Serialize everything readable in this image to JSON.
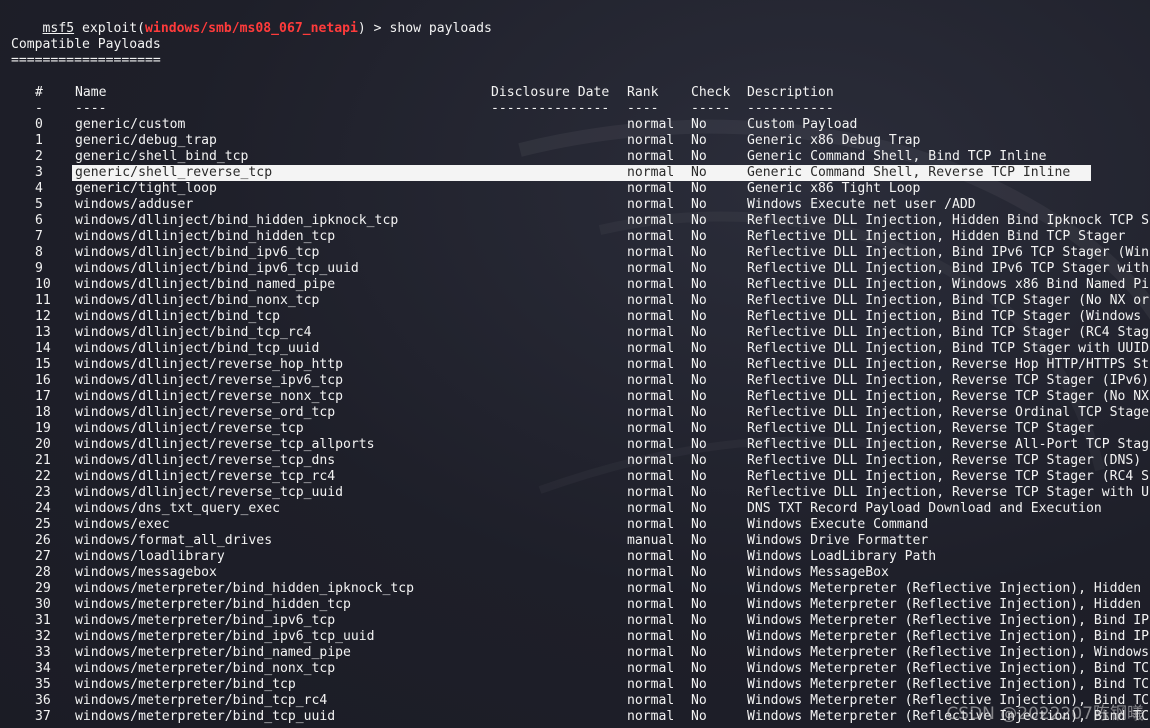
{
  "prompt": {
    "msf": "msf5",
    "exploit_prefix": " exploit(",
    "module": "windows/smb/ms08_067_netapi",
    "exploit_suffix": ") > ",
    "command": "show payloads"
  },
  "section_title": "Compatible Payloads",
  "section_underline": "===================",
  "headers": {
    "num": "#",
    "name": "Name",
    "disclosure": "Disclosure Date",
    "rank": "Rank",
    "check": "Check",
    "description": "Description"
  },
  "dividers": {
    "num": "-",
    "name": "----",
    "disclosure": "---------------",
    "rank": "----",
    "check": "-----",
    "description": "-----------"
  },
  "highlight_row": 3,
  "rows": [
    {
      "num": "0",
      "name": "generic/custom",
      "rank": "normal",
      "check": "No",
      "desc": "Custom Payload"
    },
    {
      "num": "1",
      "name": "generic/debug_trap",
      "rank": "normal",
      "check": "No",
      "desc": "Generic x86 Debug Trap"
    },
    {
      "num": "2",
      "name": "generic/shell_bind_tcp",
      "rank": "normal",
      "check": "No",
      "desc": "Generic Command Shell, Bind TCP Inline"
    },
    {
      "num": "3",
      "name": "generic/shell_reverse_tcp",
      "rank": "normal",
      "check": "No",
      "desc": "Generic Command Shell, Reverse TCP Inline"
    },
    {
      "num": "4",
      "name": "generic/tight_loop",
      "rank": "normal",
      "check": "No",
      "desc": "Generic x86 Tight Loop"
    },
    {
      "num": "5",
      "name": "windows/adduser",
      "rank": "normal",
      "check": "No",
      "desc": "Windows Execute net user /ADD"
    },
    {
      "num": "6",
      "name": "windows/dllinject/bind_hidden_ipknock_tcp",
      "rank": "normal",
      "check": "No",
      "desc": "Reflective DLL Injection, Hidden Bind Ipknock TCP S"
    },
    {
      "num": "7",
      "name": "windows/dllinject/bind_hidden_tcp",
      "rank": "normal",
      "check": "No",
      "desc": "Reflective DLL Injection, Hidden Bind TCP Stager"
    },
    {
      "num": "8",
      "name": "windows/dllinject/bind_ipv6_tcp",
      "rank": "normal",
      "check": "No",
      "desc": "Reflective DLL Injection, Bind IPv6 TCP Stager (Win"
    },
    {
      "num": "9",
      "name": "windows/dllinject/bind_ipv6_tcp_uuid",
      "rank": "normal",
      "check": "No",
      "desc": "Reflective DLL Injection, Bind IPv6 TCP Stager with"
    },
    {
      "num": "10",
      "name": "windows/dllinject/bind_named_pipe",
      "rank": "normal",
      "check": "No",
      "desc": "Reflective DLL Injection, Windows x86 Bind Named Pi"
    },
    {
      "num": "11",
      "name": "windows/dllinject/bind_nonx_tcp",
      "rank": "normal",
      "check": "No",
      "desc": "Reflective DLL Injection, Bind TCP Stager (No NX or"
    },
    {
      "num": "12",
      "name": "windows/dllinject/bind_tcp",
      "rank": "normal",
      "check": "No",
      "desc": "Reflective DLL Injection, Bind TCP Stager (Windows"
    },
    {
      "num": "13",
      "name": "windows/dllinject/bind_tcp_rc4",
      "rank": "normal",
      "check": "No",
      "desc": "Reflective DLL Injection, Bind TCP Stager (RC4 Stag"
    },
    {
      "num": "14",
      "name": "windows/dllinject/bind_tcp_uuid",
      "rank": "normal",
      "check": "No",
      "desc": "Reflective DLL Injection, Bind TCP Stager with UUID"
    },
    {
      "num": "15",
      "name": "windows/dllinject/reverse_hop_http",
      "rank": "normal",
      "check": "No",
      "desc": "Reflective DLL Injection, Reverse Hop HTTP/HTTPS St"
    },
    {
      "num": "16",
      "name": "windows/dllinject/reverse_ipv6_tcp",
      "rank": "normal",
      "check": "No",
      "desc": "Reflective DLL Injection, Reverse TCP Stager (IPv6)"
    },
    {
      "num": "17",
      "name": "windows/dllinject/reverse_nonx_tcp",
      "rank": "normal",
      "check": "No",
      "desc": "Reflective DLL Injection, Reverse TCP Stager (No NX"
    },
    {
      "num": "18",
      "name": "windows/dllinject/reverse_ord_tcp",
      "rank": "normal",
      "check": "No",
      "desc": "Reflective DLL Injection, Reverse Ordinal TCP Stage"
    },
    {
      "num": "19",
      "name": "windows/dllinject/reverse_tcp",
      "rank": "normal",
      "check": "No",
      "desc": "Reflective DLL Injection, Reverse TCP Stager"
    },
    {
      "num": "20",
      "name": "windows/dllinject/reverse_tcp_allports",
      "rank": "normal",
      "check": "No",
      "desc": "Reflective DLL Injection, Reverse All-Port TCP Stag"
    },
    {
      "num": "21",
      "name": "windows/dllinject/reverse_tcp_dns",
      "rank": "normal",
      "check": "No",
      "desc": "Reflective DLL Injection, Reverse TCP Stager (DNS)"
    },
    {
      "num": "22",
      "name": "windows/dllinject/reverse_tcp_rc4",
      "rank": "normal",
      "check": "No",
      "desc": "Reflective DLL Injection, Reverse TCP Stager (RC4 S"
    },
    {
      "num": "23",
      "name": "windows/dllinject/reverse_tcp_uuid",
      "rank": "normal",
      "check": "No",
      "desc": "Reflective DLL Injection, Reverse TCP Stager with U"
    },
    {
      "num": "24",
      "name": "windows/dns_txt_query_exec",
      "rank": "normal",
      "check": "No",
      "desc": "DNS TXT Record Payload Download and Execution"
    },
    {
      "num": "25",
      "name": "windows/exec",
      "rank": "normal",
      "check": "No",
      "desc": "Windows Execute Command"
    },
    {
      "num": "26",
      "name": "windows/format_all_drives",
      "rank": "manual",
      "check": "No",
      "desc": "Windows Drive Formatter"
    },
    {
      "num": "27",
      "name": "windows/loadlibrary",
      "rank": "normal",
      "check": "No",
      "desc": "Windows LoadLibrary Path"
    },
    {
      "num": "28",
      "name": "windows/messagebox",
      "rank": "normal",
      "check": "No",
      "desc": "Windows MessageBox"
    },
    {
      "num": "29",
      "name": "windows/meterpreter/bind_hidden_ipknock_tcp",
      "rank": "normal",
      "check": "No",
      "desc": "Windows Meterpreter (Reflective Injection), Hidden"
    },
    {
      "num": "30",
      "name": "windows/meterpreter/bind_hidden_tcp",
      "rank": "normal",
      "check": "No",
      "desc": "Windows Meterpreter (Reflective Injection), Hidden"
    },
    {
      "num": "31",
      "name": "windows/meterpreter/bind_ipv6_tcp",
      "rank": "normal",
      "check": "No",
      "desc": "Windows Meterpreter (Reflective Injection), Bind IP"
    },
    {
      "num": "32",
      "name": "windows/meterpreter/bind_ipv6_tcp_uuid",
      "rank": "normal",
      "check": "No",
      "desc": "Windows Meterpreter (Reflective Injection), Bind IP"
    },
    {
      "num": "33",
      "name": "windows/meterpreter/bind_named_pipe",
      "rank": "normal",
      "check": "No",
      "desc": "Windows Meterpreter (Reflective Injection), Windows"
    },
    {
      "num": "34",
      "name": "windows/meterpreter/bind_nonx_tcp",
      "rank": "normal",
      "check": "No",
      "desc": "Windows Meterpreter (Reflective Injection), Bind TC"
    },
    {
      "num": "35",
      "name": "windows/meterpreter/bind_tcp",
      "rank": "normal",
      "check": "No",
      "desc": "Windows Meterpreter (Reflective Injection), Bind TC"
    },
    {
      "num": "36",
      "name": "windows/meterpreter/bind_tcp_rc4",
      "rank": "normal",
      "check": "No",
      "desc": "Windows Meterpreter (Reflective Injection), Bind TC"
    },
    {
      "num": "37",
      "name": "windows/meterpreter/bind_tcp_uuid",
      "rank": "normal",
      "check": "No",
      "desc": "Windows Meterpreter (Reflective Injection), Bind TC"
    }
  ],
  "watermark_text": "CSDN @2022207陈钢曦",
  "colors": {
    "background": "#1e1f29",
    "text": "#f3f3f3",
    "module": "#ff3b3b",
    "highlight": "#f4f4f4"
  }
}
